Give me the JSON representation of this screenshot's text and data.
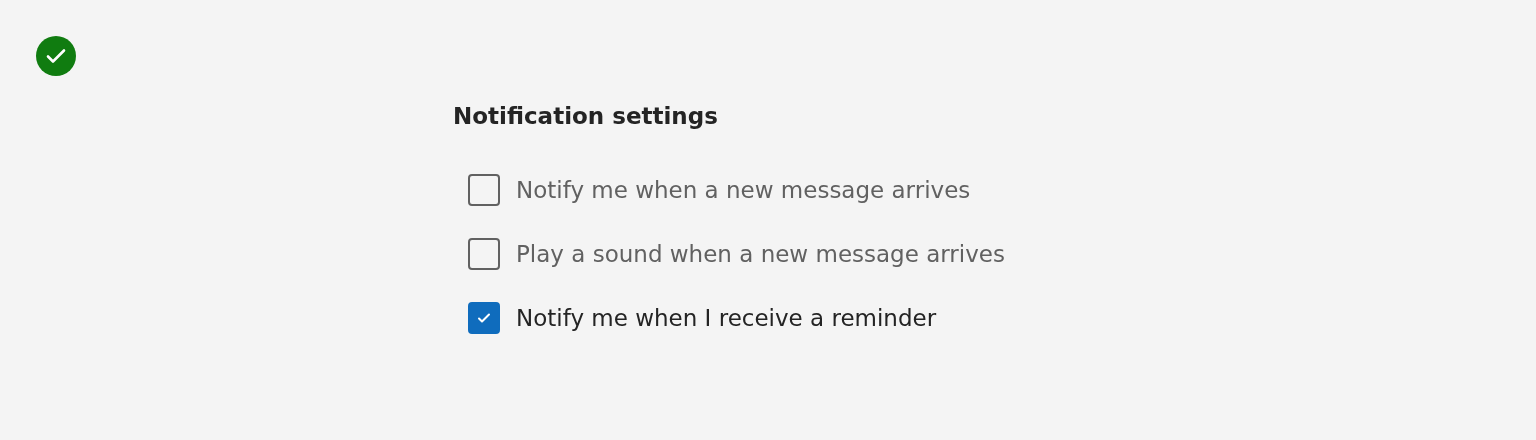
{
  "status": {
    "kind": "success"
  },
  "title": "Notification settings",
  "options": [
    {
      "label": "Notify me when a new message arrives",
      "checked": false
    },
    {
      "label": "Play a sound when a new message arrives",
      "checked": false
    },
    {
      "label": "Notify me when I receive a reminder",
      "checked": true
    }
  ]
}
